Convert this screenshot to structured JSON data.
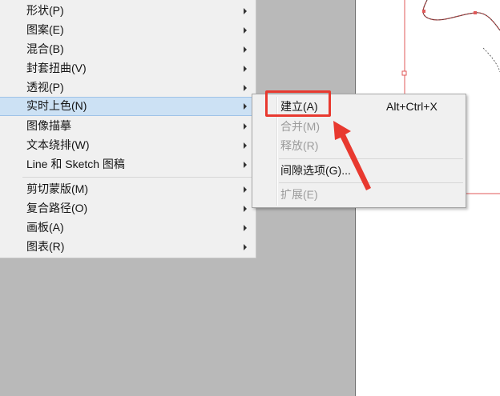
{
  "main_menu": {
    "items": [
      {
        "label": "形状(P)",
        "has_submenu": true
      },
      {
        "label": "图案(E)",
        "has_submenu": true
      },
      {
        "label": "混合(B)",
        "has_submenu": true
      },
      {
        "label": "封套扭曲(V)",
        "has_submenu": true
      },
      {
        "label": "透视(P)",
        "has_submenu": true
      },
      {
        "label": "实时上色(N)",
        "has_submenu": true,
        "highlighted": true
      },
      {
        "label": "图像描摹",
        "has_submenu": true
      },
      {
        "label": "文本绕排(W)",
        "has_submenu": true
      },
      {
        "label": "Line 和 Sketch 图稿",
        "has_submenu": true
      },
      {
        "label": "剪切蒙版(M)",
        "has_submenu": true
      },
      {
        "label": "复合路径(O)",
        "has_submenu": true
      },
      {
        "label": "画板(A)",
        "has_submenu": true
      },
      {
        "label": "图表(R)",
        "has_submenu": true
      }
    ]
  },
  "submenu": {
    "items": [
      {
        "label": "建立(A)",
        "shortcut": "Alt+Ctrl+X",
        "enabled": true
      },
      {
        "label": "合并(M)",
        "enabled": false
      },
      {
        "label": "释放(R)",
        "enabled": false
      },
      {
        "label": "间隙选项(G)...",
        "enabled": true
      },
      {
        "label": "扩展(E)",
        "enabled": false
      }
    ]
  },
  "colors": {
    "menu_bg": "#f0f0f0",
    "highlight_bg": "#cce1f4",
    "annotation_red": "#e8392f",
    "workspace_bg": "#b9b9b9",
    "disabled_text": "#9c9c9c"
  },
  "icons": [
    "submenu-arrow-icon",
    "annotation-arrow-icon"
  ]
}
